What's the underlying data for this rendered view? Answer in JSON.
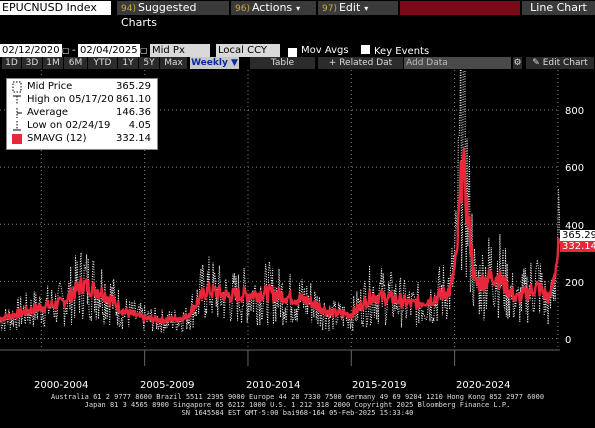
{
  "toolbar": {
    "ticker": "EPUCNUSD Index",
    "suggested_num": "94)",
    "suggested": "Suggested Charts",
    "actions_num": "96)",
    "actions": "Actions",
    "edit_num": "97)",
    "edit": "Edit",
    "line_chart": "Line Chart"
  },
  "controls": {
    "start_date": "02/12/2020",
    "end_date": "02/04/2025",
    "field": "Mid Px",
    "currency": "Local CCY",
    "mov_avgs": "Mov Avgs",
    "key_events": "Key Events"
  },
  "periods": [
    "1D",
    "3D",
    "1M",
    "6M",
    "YTD",
    "1Y",
    "5Y",
    "Max"
  ],
  "frequency": "Weekly",
  "buttons": {
    "table": "Table",
    "related": "Related Dat",
    "add_data": "Add Data",
    "edit_chart": "Edit Chart"
  },
  "legend": {
    "mid": {
      "label": "Mid Price",
      "value": "365.29"
    },
    "high": {
      "label": "High on 05/17/20",
      "value": "861.10"
    },
    "avg": {
      "label": "Average",
      "value": "146.36"
    },
    "low": {
      "label": "Low on 02/24/19",
      "value": "4.05"
    },
    "sma": {
      "label": "SMAVG (12)",
      "value": "332.14"
    }
  },
  "axis": {
    "y_ticks": [
      "800",
      "600",
      "400",
      "200",
      "0"
    ],
    "x_labels": [
      "2000-2004",
      "2005-2009",
      "2010-2014",
      "2015-2019",
      "2020-2024"
    ]
  },
  "footer": {
    "line1": "Australia 61 2 9777 8600 Brazil 5511 2395 9000 Europe 44 20 7330 7500 Germany 49 69 9204 1210 Hong Kong 852 2977 6000",
    "line2": "Japan 81 3 4565 8900      Singapore 65 6212 1000      U.S. 1 212 318 2000           Copyright 2025 Bloomberg Finance L.P.",
    "line3": "SN 1645584 EST  GMT-5:00 bai968-164 05-Feb-2025 15:33:40"
  },
  "colors": {
    "mid": "#ffffff",
    "sma": "#e8283a",
    "grid": "#7d7d7d",
    "bg": "#000000"
  },
  "chart_data": {
    "type": "line",
    "x_range": [
      "1998",
      "2025"
    ],
    "ylim": [
      -40,
      940
    ],
    "grid": true,
    "legend_position": "top-left",
    "series": [
      {
        "name": "Mid Price",
        "style": "dotted",
        "x": [
          1998,
          1999,
          2000,
          2001,
          2002,
          2003,
          2004,
          2005,
          2006,
          2007,
          2008,
          2009,
          2010,
          2011,
          2012,
          2013,
          2014,
          2015,
          2016,
          2017,
          2018,
          2019,
          2019.8,
          2020.1,
          2020.38,
          2020.6,
          2021,
          2022,
          2023,
          2024,
          2024.6,
          2025.1
        ],
        "values": [
          60,
          90,
          110,
          120,
          200,
          170,
          90,
          70,
          60,
          70,
          180,
          140,
          150,
          160,
          140,
          130,
          80,
          80,
          160,
          140,
          110,
          140,
          180,
          300,
          861,
          500,
          180,
          250,
          120,
          200,
          100,
          365
        ]
      },
      {
        "name": "SMAVG (12)",
        "style": "solid",
        "x": [
          1998,
          1999,
          2000,
          2001,
          2002,
          2003,
          2004,
          2005,
          2006,
          2007,
          2008,
          2009,
          2010,
          2011,
          2012,
          2013,
          2014,
          2015,
          2016,
          2017,
          2018,
          2019,
          2019.8,
          2020.1,
          2020.38,
          2020.6,
          2021,
          2022,
          2023,
          2024,
          2024.6,
          2025.1
        ],
        "values": [
          70,
          90,
          110,
          125,
          190,
          160,
          95,
          70,
          65,
          75,
          170,
          150,
          155,
          160,
          145,
          130,
          90,
          85,
          150,
          140,
          120,
          140,
          170,
          280,
          630,
          450,
          190,
          220,
          140,
          180,
          140,
          332
        ]
      }
    ]
  }
}
